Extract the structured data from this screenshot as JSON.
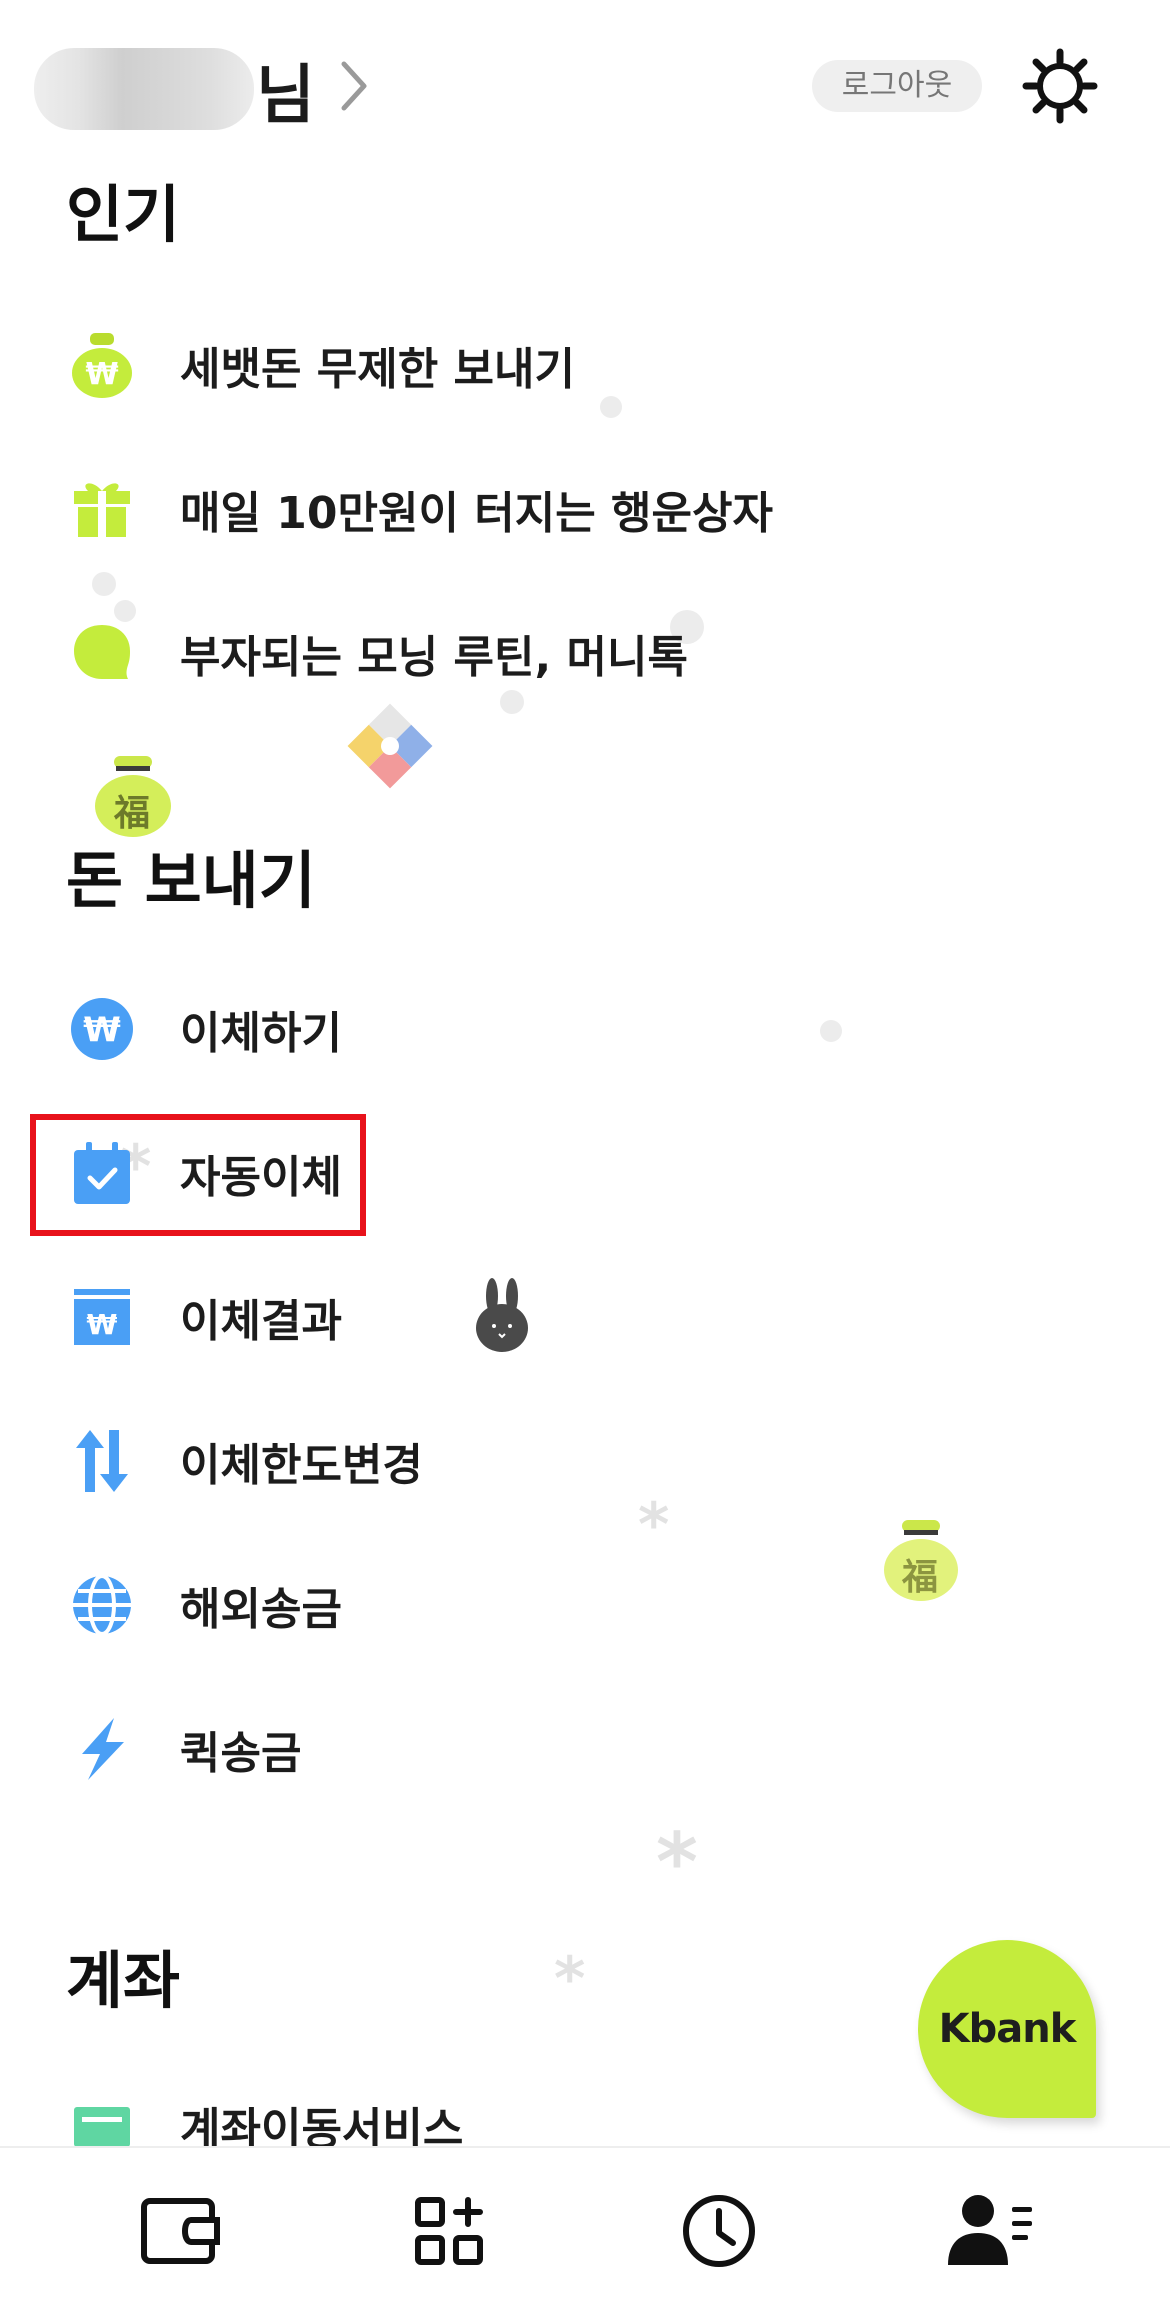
{
  "header": {
    "user_suffix": "님",
    "logout_label": "로그아웃"
  },
  "sections": {
    "popular": {
      "title": "인기",
      "items": [
        {
          "label": "세뱃돈 무제한 보내기",
          "icon": "money-bag-icon"
        },
        {
          "label": "매일 10만원이 터지는 행운상자",
          "icon": "gift-box-icon"
        },
        {
          "label": "부자되는 모닝 루틴, 머니톡",
          "icon": "speech-bubble-icon"
        }
      ]
    },
    "send_money": {
      "title": "돈 보내기",
      "items": [
        {
          "label": "이체하기",
          "icon": "won-coin-icon"
        },
        {
          "label": "자동이체",
          "icon": "calendar-check-icon"
        },
        {
          "label": "이체결과",
          "icon": "receipt-icon"
        },
        {
          "label": "이체한도변경",
          "icon": "up-down-arrows-icon"
        },
        {
          "label": "해외송금",
          "icon": "globe-icon"
        },
        {
          "label": "퀵송금",
          "icon": "lightning-icon"
        }
      ]
    },
    "account": {
      "title": "계좌",
      "items": [
        {
          "label": "계좌이동서비스",
          "icon": "card-transfer-icon"
        }
      ]
    }
  },
  "decorations": {
    "lucky_bag_char": "福"
  },
  "fab": {
    "label": "Kbank"
  },
  "bottom_nav": [
    "wallet-icon",
    "apps-add-icon",
    "clock-icon",
    "menu-profile-icon"
  ],
  "colors": {
    "accent_green": "#C4EC3C",
    "accent_blue": "#4A9FF5",
    "highlight_red": "#E8121B"
  }
}
